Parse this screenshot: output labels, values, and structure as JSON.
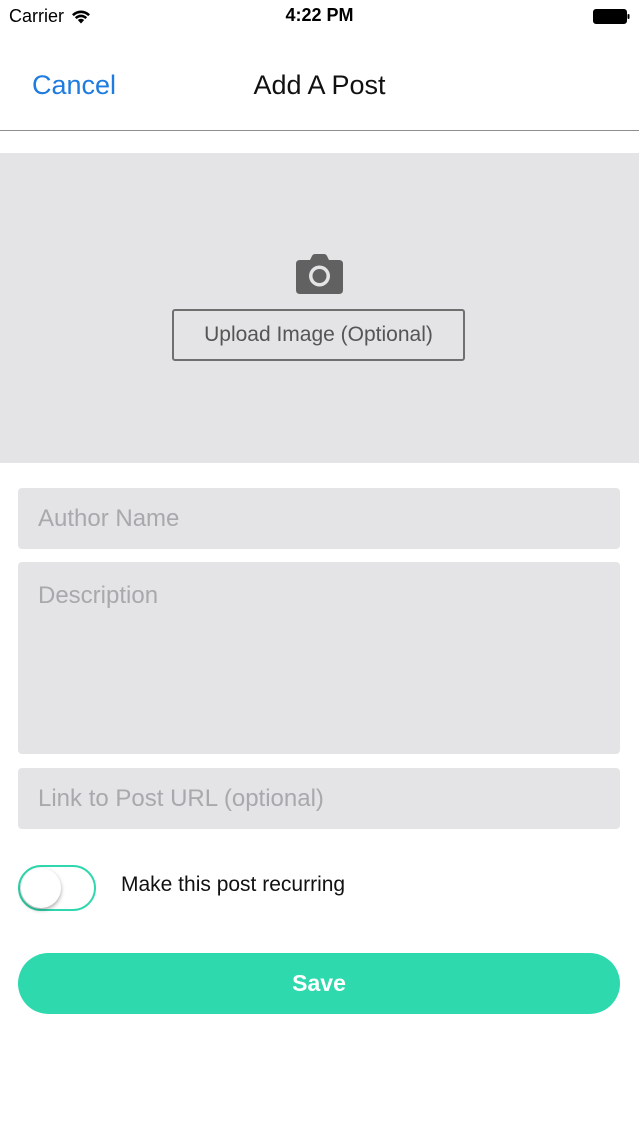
{
  "status_bar": {
    "carrier": "Carrier",
    "time": "4:22 PM",
    "wifi_icon": "wifi-icon",
    "battery_icon": "battery-icon"
  },
  "nav": {
    "cancel_label": "Cancel",
    "title": "Add A Post"
  },
  "upload": {
    "icon": "camera-icon",
    "button_label": "Upload Image (Optional)"
  },
  "form": {
    "author_placeholder": "Author Name",
    "author_value": "",
    "description_placeholder": "Description",
    "description_value": "",
    "url_placeholder": "Link to Post URL (optional)",
    "url_value": "",
    "recurring_label": "Make this post recurring",
    "recurring_on": false,
    "save_label": "Save"
  },
  "colors": {
    "accent": "#2ed9ae",
    "link": "#1e7be0",
    "field_bg": "#e4e4e6"
  }
}
